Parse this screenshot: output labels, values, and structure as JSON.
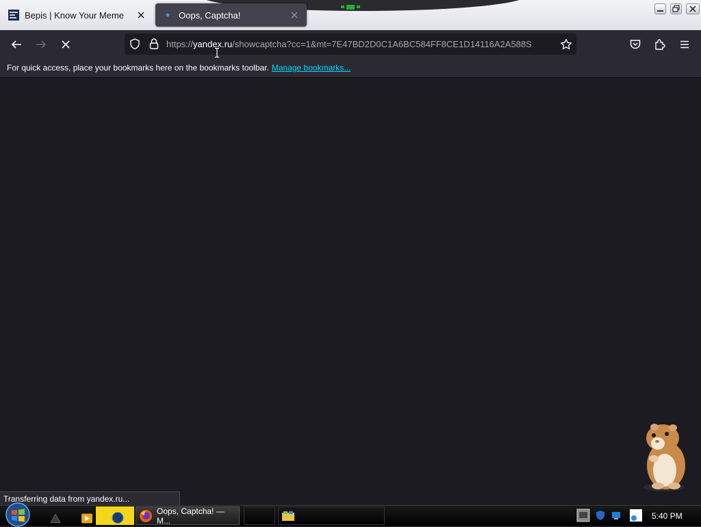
{
  "browser": {
    "tabs": [
      {
        "title": "Bepis | Know Your Meme",
        "active": false
      },
      {
        "title": "Oops, Captcha!",
        "active": true
      }
    ],
    "url": {
      "scheme": "https://",
      "host": "yandex.ru",
      "path": "/showcaptcha?cc=1&mt=7E47BD2D0C1A6BC584FF8CE1D14116A2A588S"
    },
    "bookmarks_message": "For quick access, place your bookmarks here on the bookmarks toolbar.",
    "manage_bookmarks": "Manage bookmarks...",
    "status_text": "Transferring data from yandex.ru..."
  },
  "taskbar": {
    "task_label": "Oops, Captcha! — M...",
    "clock": "5:40 PM"
  },
  "icons": [
    "meme-favicon",
    "yandex-favicon",
    "close-icon",
    "back-icon",
    "forward-icon",
    "stop-icon",
    "shield-icon",
    "lock-icon",
    "star-icon",
    "pocket-icon",
    "extensions-icon",
    "menu-icon",
    "hamster-image",
    "start-orb-icon",
    "firefox-icon"
  ],
  "colors": {
    "toolbar": "#2b2a33",
    "content": "#1c1b22",
    "link": "#00ddff",
    "active_tab": "#42414d"
  }
}
